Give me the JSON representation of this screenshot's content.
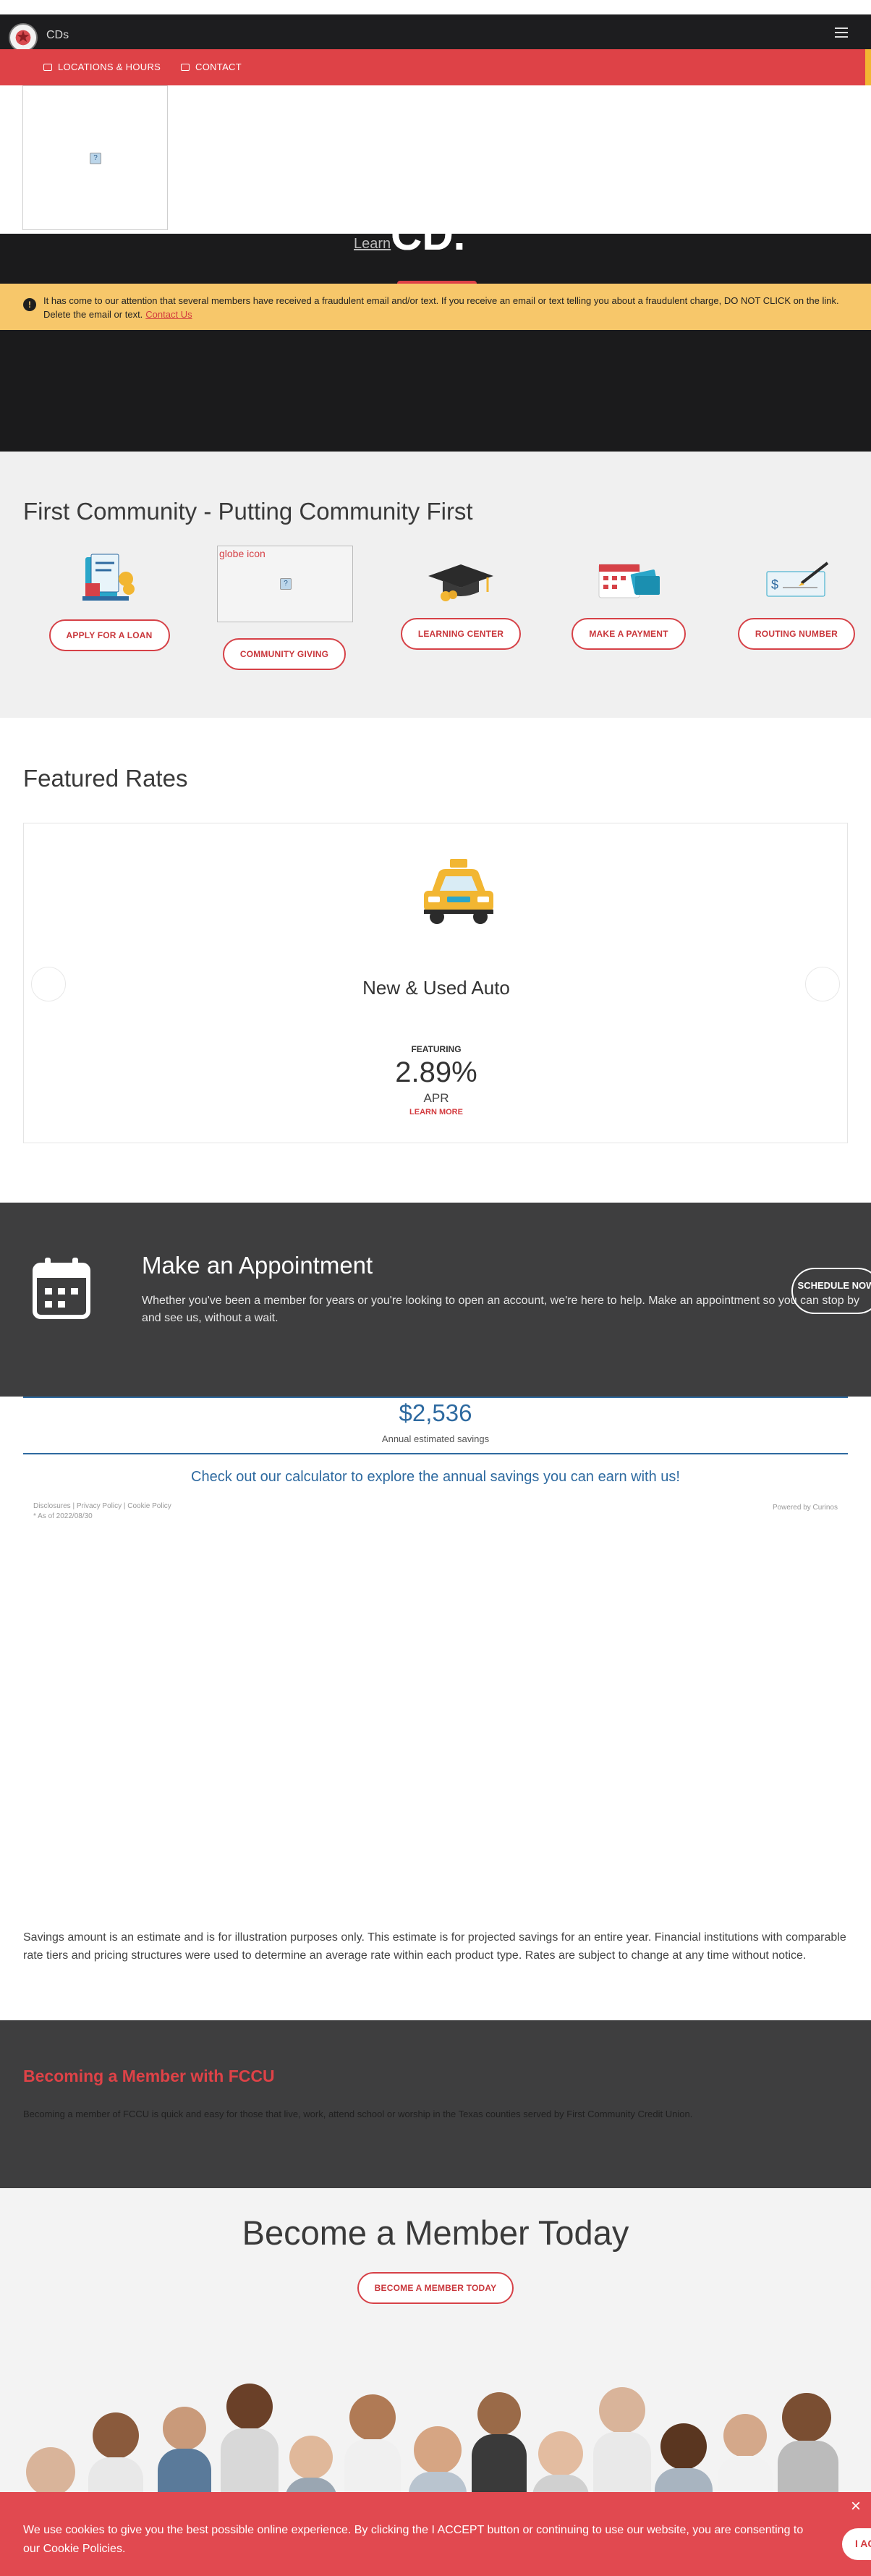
{
  "header": {
    "title": "CDs",
    "nav_links": [
      "LOCATIONS & HOURS",
      "CONTACT"
    ]
  },
  "hero": {
    "headline": "CD.",
    "learn_link": "Learn"
  },
  "alert": {
    "message": "It has come to our attention that several members have received a fraudulent email and/or text. If you receive an email or text telling you about a fraudulent charge, DO NOT CLICK on the link. Delete the email or text.",
    "contact_link": "Contact Us"
  },
  "community": {
    "heading": "First Community - Putting Community First",
    "globe_alt": "globe icon",
    "buttons": [
      "APPLY FOR A LOAN",
      "COMMUNITY GIVING",
      "LEARNING CENTER",
      "MAKE A PAYMENT",
      "ROUTING NUMBER"
    ]
  },
  "rates": {
    "heading": "Featured Rates",
    "product": "New & Used Auto",
    "featuring_label": "FEATURING",
    "rate": "2.89%",
    "rate_unit": "APR",
    "learn_more": "LEARN MORE"
  },
  "appointment": {
    "heading": "Make an Appointment",
    "text": "Whether you've been a member for years or you're looking to open an account, we're here to help. Make an appointment so you can stop by and see us, without a wait.",
    "button": "SCHEDULE NOW"
  },
  "savings": {
    "amount": "$2,536",
    "amount_label": "Annual estimated savings",
    "calculator_link": "Check out our calculator to explore the annual savings you can earn with us!",
    "disclosure_links": "Disclosures | Privacy Policy | Cookie Policy",
    "as_of": "* As of 2022/08/30",
    "powered_by": "Powered by Curinos",
    "fine_print": "Savings amount is an estimate and is for illustration purposes only. This estimate is for projected savings for an entire year. Financial institutions with comparable rate tiers and pricing structures were used to determine an average rate within each product type. Rates are subject to change at any time without notice."
  },
  "becoming": {
    "heading": "Becoming a Member with FCCU",
    "text": "Becoming a member of FCCU is quick and easy for those that live, work, attend school or worship in the Texas counties served by First Community Credit Union."
  },
  "become_member": {
    "heading": "Become a Member Today",
    "button": "BECOME A MEMBER TODAY"
  },
  "cookie": {
    "message": "We use cookies to give you the best possible online experience. By clicking the I ACCEPT button or continuing to use our website, you are consenting to our Cookie Policies.",
    "accept": "I ACCEPT",
    "close": "×"
  },
  "colors": {
    "brand_red": "#de4247",
    "alert_yellow": "#f7c76a",
    "dark": "#1b1b1c",
    "savings_blue": "#2e6aa0"
  }
}
